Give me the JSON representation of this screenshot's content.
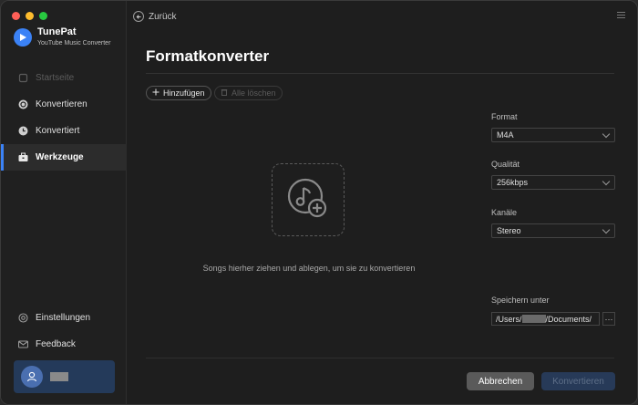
{
  "app": {
    "name": "TunePat",
    "subtitle": "YouTube Music Converter"
  },
  "sidebar": {
    "items": [
      {
        "label": "Startseite",
        "icon": "home-icon",
        "state": "disabled"
      },
      {
        "label": "Konvertieren",
        "icon": "convert-icon",
        "state": "normal"
      },
      {
        "label": "Konvertiert",
        "icon": "clock-icon",
        "state": "normal"
      },
      {
        "label": "Werkzeuge",
        "icon": "toolbox-icon",
        "state": "active"
      }
    ],
    "bottom_items": [
      {
        "label": "Einstellungen",
        "icon": "gear-icon"
      },
      {
        "label": "Feedback",
        "icon": "mail-icon"
      }
    ]
  },
  "header": {
    "back_label": "Zurück"
  },
  "main": {
    "title": "Formatkonverter",
    "add_label": "Hinzufügen",
    "clear_label": "Alle löschen",
    "drop_text": "Songs hierher ziehen und ablegen, um sie zu konvertieren"
  },
  "settings": {
    "format_label": "Format",
    "format_value": "M4A",
    "quality_label": "Qualität",
    "quality_value": "256kbps",
    "channels_label": "Kanäle",
    "channels_value": "Stereo",
    "save_label": "Speichern unter",
    "path_prefix": "/Users/",
    "path_suffix": "/Documents/",
    "browse_label": "···"
  },
  "footer": {
    "cancel_label": "Abbrechen",
    "convert_label": "Konvertieren"
  },
  "colors": {
    "accent": "#3b82f6",
    "active_indicator": "#3b82f6",
    "account_bg": "#243a5a"
  }
}
